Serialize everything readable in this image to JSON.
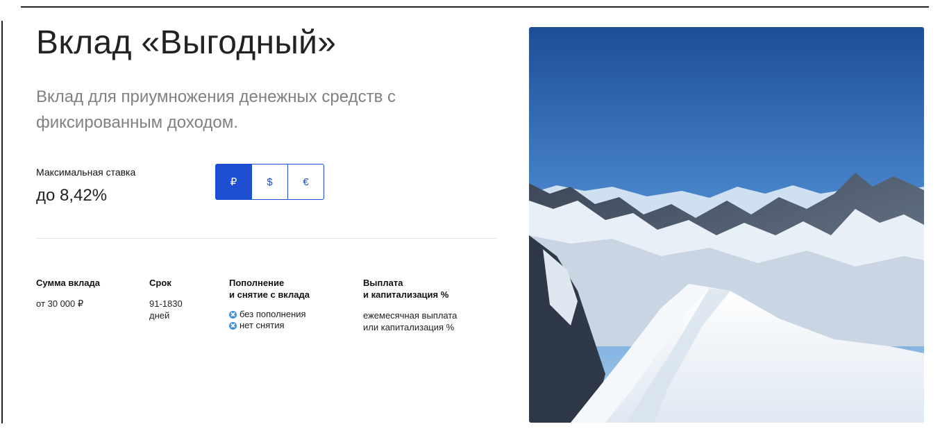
{
  "deposit": {
    "title": "Вклад «Выгодный»",
    "subtitle": "Вклад для приумножения денежных средств с фиксированным доходом.",
    "max_rate_label": "Максимальная ставка",
    "max_rate_value": "до 8,42%"
  },
  "currencies": [
    {
      "symbol": "₽",
      "selected": true
    },
    {
      "symbol": "$",
      "selected": false
    },
    {
      "symbol": "€",
      "selected": false
    }
  ],
  "details": {
    "amount": {
      "label": "Сумма вклада",
      "value": "от 30 000 ₽"
    },
    "term": {
      "label": "Срок",
      "value_lines": [
        "91-1830",
        "дней"
      ]
    },
    "replenishment": {
      "label_lines": [
        "Пополнение",
        "и снятие с вклада"
      ],
      "items": [
        {
          "icon": "x-circle-icon",
          "text": "без пополнения"
        },
        {
          "icon": "x-circle-icon",
          "text": "нет снятия"
        }
      ]
    },
    "payout": {
      "label_lines": [
        "Выплата",
        "и капитализация %"
      ],
      "value_lines": [
        "ежемесячная выплата",
        "или капитализация %"
      ]
    }
  },
  "colors": {
    "accent": "#1e4fd2",
    "icon": "#3f8fe0",
    "subtitle": "#808080"
  }
}
